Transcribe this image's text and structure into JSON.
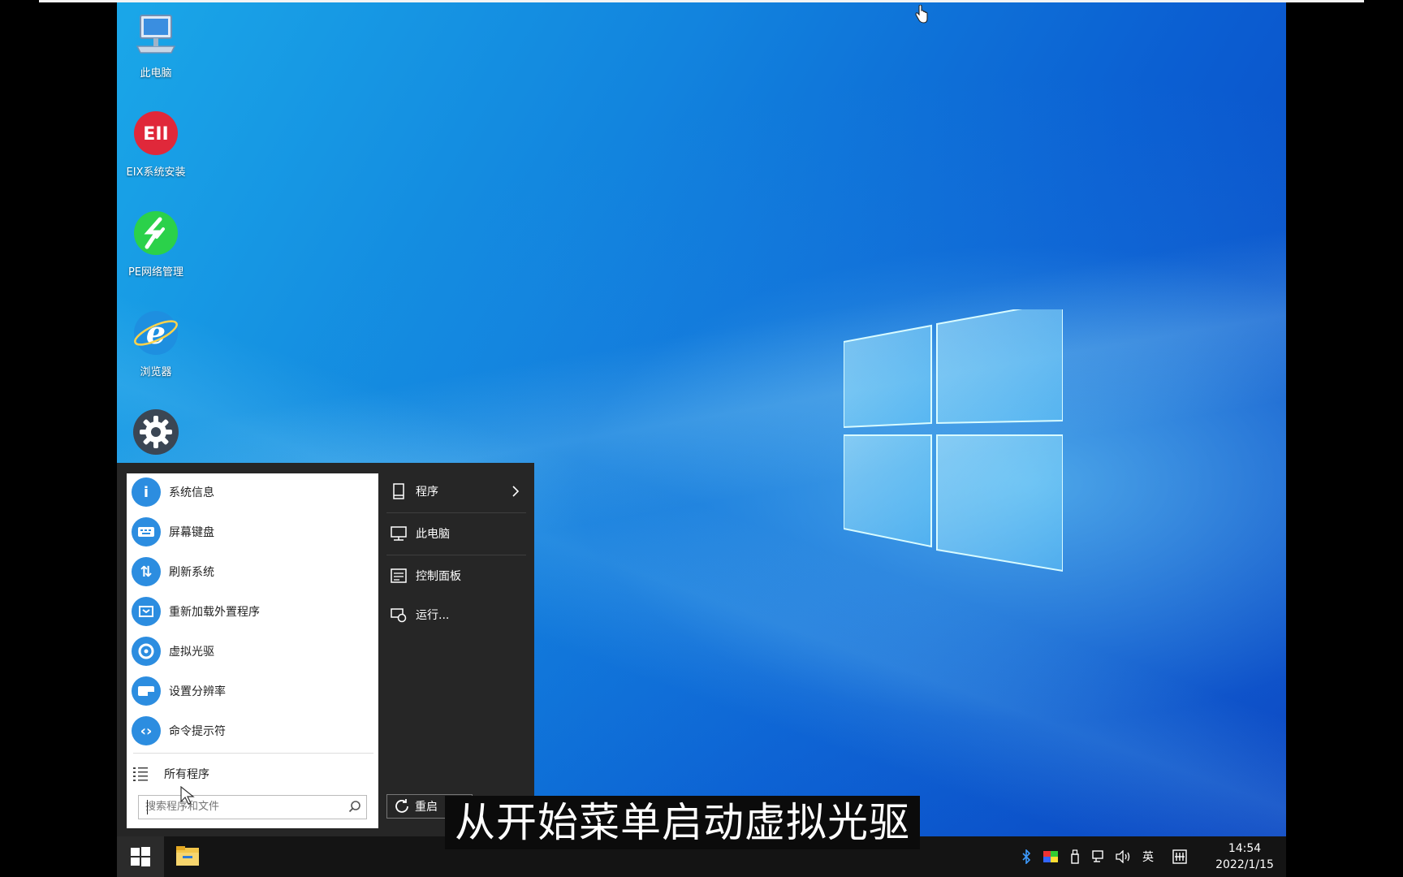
{
  "desktop": {
    "icons": [
      {
        "label": "此电脑",
        "icon": "computer-icon"
      },
      {
        "label": "EIX系统安装",
        "icon": "eix-installer-icon",
        "logo_text": "EII"
      },
      {
        "label": "PE网络管理",
        "icon": "network-manager-icon"
      },
      {
        "label": "浏览器",
        "icon": "browser-icon"
      },
      {
        "label": "",
        "icon": "settings-gear-icon"
      }
    ]
  },
  "start_menu": {
    "left_items": [
      {
        "label": "系统信息",
        "icon": "info-icon"
      },
      {
        "label": "屏幕键盘",
        "icon": "keyboard-icon"
      },
      {
        "label": "刷新系统",
        "icon": "refresh-system-icon"
      },
      {
        "label": "重新加载外置程序",
        "icon": "reload-programs-icon"
      },
      {
        "label": "虚拟光驱",
        "icon": "virtual-drive-icon"
      },
      {
        "label": "设置分辨率",
        "icon": "resolution-icon"
      },
      {
        "label": "命令提示符",
        "icon": "command-prompt-icon"
      }
    ],
    "all_programs": "所有程序",
    "search_placeholder": "搜索程序和文件",
    "right_items": [
      {
        "label": "程序",
        "icon": "programs-icon"
      },
      {
        "label": "此电脑",
        "icon": "computer-icon"
      },
      {
        "label": "控制面板",
        "icon": "control-panel-icon"
      },
      {
        "label": "运行...",
        "icon": "run-icon"
      }
    ],
    "restart_label": "重启"
  },
  "taskbar": {
    "time": "14:54",
    "date": "2022/1/15",
    "ime": "英"
  },
  "subtitle": "从开始菜单启动虚拟光驱",
  "colors": {
    "menu_dark": "#262626",
    "accent": "#2c8de0",
    "taskbar": "#141414"
  }
}
